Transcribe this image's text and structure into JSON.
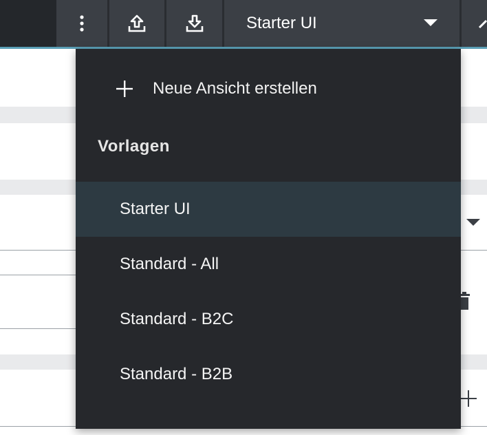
{
  "toolbar": {
    "more_icon": "more-vertical-icon",
    "upload_icon": "upload-icon",
    "download_icon": "download-icon",
    "view_select": {
      "value": "Starter UI",
      "caret_icon": "caret-down-icon"
    }
  },
  "menu": {
    "create_action": {
      "icon": "plus-icon",
      "label": "Neue Ansicht erstellen"
    },
    "section_title": "Vorlagen",
    "items": [
      {
        "label": "Starter UI",
        "selected": true
      },
      {
        "label": "Standard - All",
        "selected": false
      },
      {
        "label": "Standard - B2C",
        "selected": false
      },
      {
        "label": "Standard - B2B",
        "selected": false
      }
    ]
  },
  "colors": {
    "toolbar_bg": "#353a40",
    "menu_bg": "#26282c",
    "selected_bg": "#2d3a42",
    "accent": "#5a9fb6"
  }
}
